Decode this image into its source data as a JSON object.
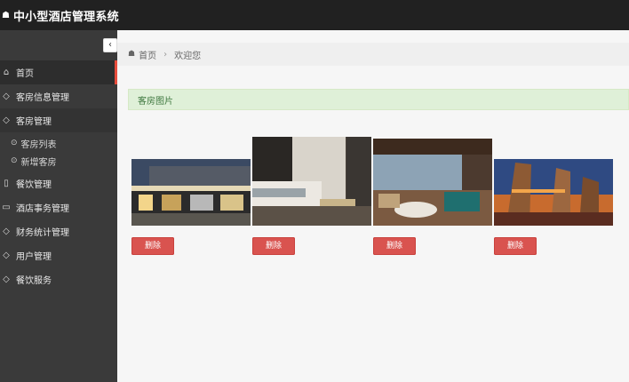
{
  "app": {
    "title": "中小型酒店管理系统",
    "home_icon": "home-icon"
  },
  "sidebar": {
    "collapse_glyph": "‹",
    "items": [
      {
        "label": "首页",
        "icon": "home-icon",
        "state": "active"
      },
      {
        "label": "客房信息管理",
        "icon": "tag-icon"
      },
      {
        "label": "客房管理",
        "icon": "tag-icon",
        "state": "open",
        "children": [
          {
            "label": "客房列表",
            "icon": "circle-arrow-icon"
          },
          {
            "label": "新增客房",
            "icon": "circle-arrow-icon"
          }
        ]
      },
      {
        "label": "餐饮管理",
        "icon": "book-icon"
      },
      {
        "label": "酒店事务管理",
        "icon": "folder-icon"
      },
      {
        "label": "财务统计管理",
        "icon": "tag-icon"
      },
      {
        "label": "用户管理",
        "icon": "tag-icon"
      },
      {
        "label": "餐饮服务",
        "icon": "tag-icon"
      }
    ]
  },
  "breadcrumb": {
    "home": "首页",
    "current": "欢迎您"
  },
  "panel": {
    "heading": "客房图片"
  },
  "photos": [
    {
      "name": "hotel-exterior-night",
      "delete_label": "删除"
    },
    {
      "name": "hotel-bedroom",
      "delete_label": "删除"
    },
    {
      "name": "hotel-lounge",
      "delete_label": "删除"
    },
    {
      "name": "hotel-towers-dusk",
      "delete_label": "删除"
    }
  ],
  "colors": {
    "topbar": "#212121",
    "sidebar": "#3a3a3a",
    "accent": "#e74c3c",
    "danger": "#d9534f",
    "alert_bg": "#dff0d8",
    "alert_text": "#3c763d"
  }
}
